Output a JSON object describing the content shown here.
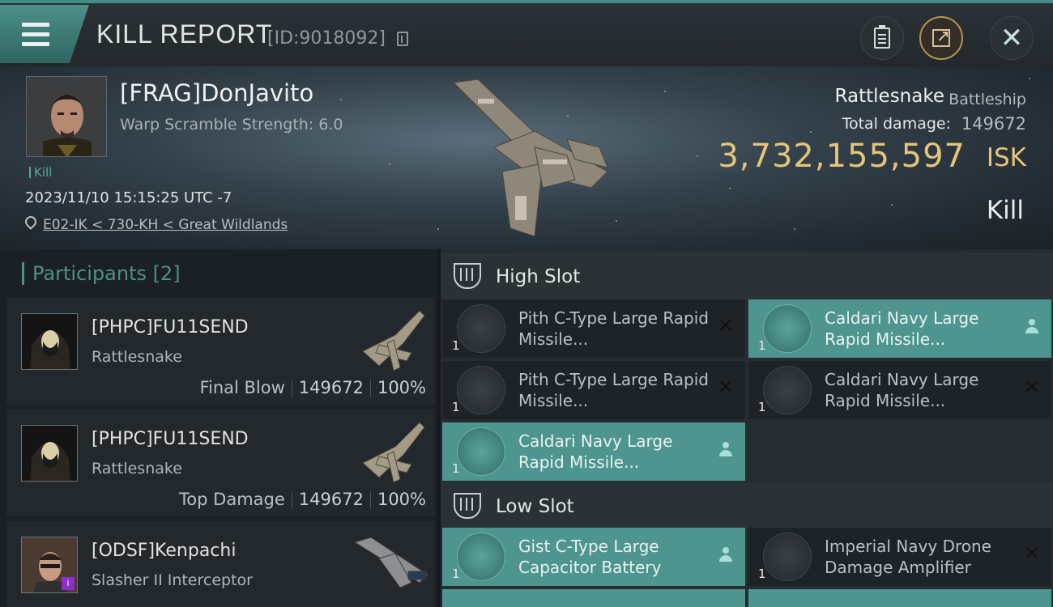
{
  "header": {
    "title": "KILL REPORT",
    "report_id": "[ID:9018092]"
  },
  "victim": {
    "name": "[FRAG]DonJavito",
    "warp_scramble": "Warp Scramble Strength: 6.0",
    "kill_tag": "Kill",
    "datetime": "2023/11/10 15:15:25 UTC -7",
    "location": "E02-IK < 730-KH < Great Wildlands",
    "ship_name": "Rattlesnake",
    "ship_class": "Battleship",
    "total_damage_label": "Total damage:",
    "total_damage": "149672",
    "isk_value": "3,732,155,597",
    "isk_unit": "ISK",
    "result": "Kill"
  },
  "participants": {
    "title": "Participants [2]",
    "items": [
      {
        "name": "[PHPC]FU11SEND",
        "ship": "Rattlesnake",
        "role": "Final Blow",
        "damage": "149672",
        "percent": "100%"
      },
      {
        "name": "[PHPC]FU11SEND",
        "ship": "Rattlesnake",
        "role": "Top Damage",
        "damage": "149672",
        "percent": "100%"
      },
      {
        "name": "[ODSF]Kenpachi",
        "ship": "Slasher II Interceptor",
        "role": "",
        "damage": "",
        "percent": ""
      }
    ]
  },
  "high_slot": {
    "title": "High Slot",
    "modules": [
      {
        "qty": "1",
        "name": "Pith C-Type Large Rapid Missile...",
        "status": "destroyed"
      },
      {
        "qty": "1",
        "name": "Caldari Navy Large Rapid Missile...",
        "status": "dropped"
      },
      {
        "qty": "1",
        "name": "Pith C-Type Large Rapid Missile...",
        "status": "destroyed"
      },
      {
        "qty": "1",
        "name": "Caldari Navy Large Rapid Missile...",
        "status": "destroyed"
      },
      {
        "qty": "1",
        "name": "Caldari Navy Large Rapid Missile...",
        "status": "dropped"
      }
    ]
  },
  "low_slot": {
    "title": "Low Slot",
    "modules": [
      {
        "qty": "1",
        "name": "Gist C-Type Large Capacitor Battery",
        "status": "dropped"
      },
      {
        "qty": "1",
        "name": "Imperial Navy Drone Damage Amplifier",
        "status": "destroyed"
      }
    ]
  },
  "colors": {
    "accent_teal": "#4e958f",
    "isk_gold": "#e6c479",
    "header_bg": "#2b3135"
  },
  "icons": [
    "menu-icon",
    "copy-icon",
    "clipboard-icon",
    "share-icon",
    "close-icon",
    "location-pin-icon",
    "person-icon",
    "x-icon",
    "slot-icon"
  ]
}
